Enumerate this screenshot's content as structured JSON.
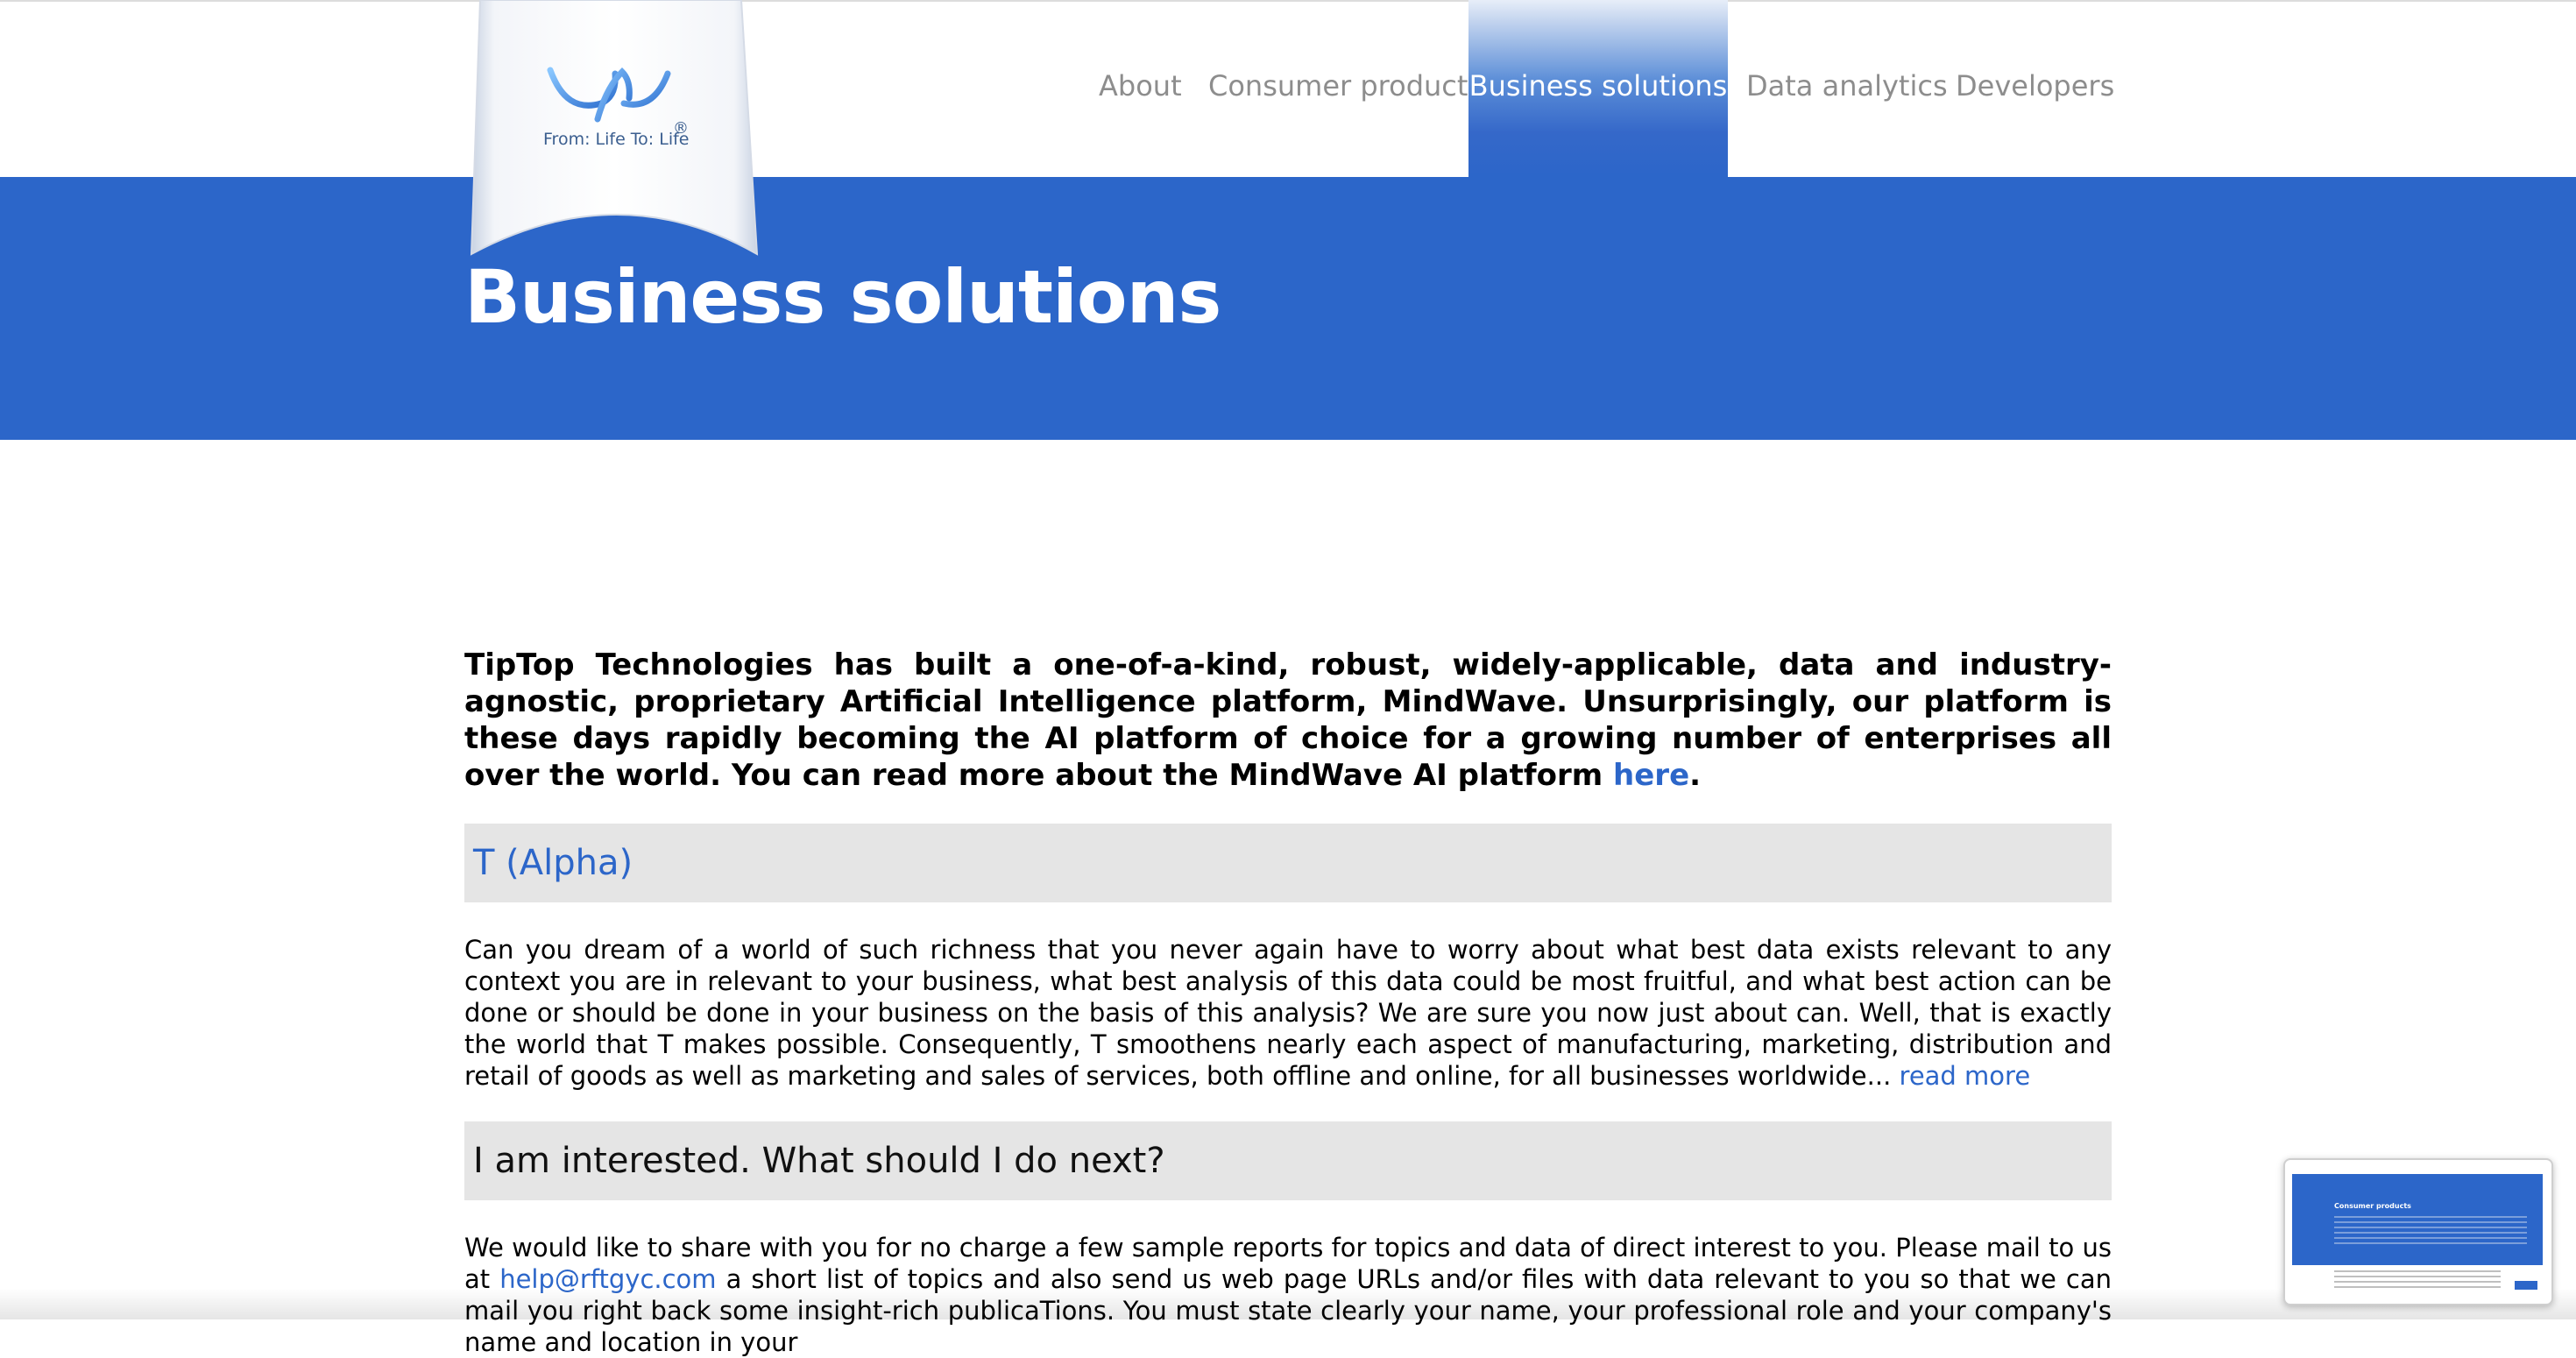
{
  "brand": {
    "tagline": "From: Life To: Life",
    "registered_mark": "®"
  },
  "nav": {
    "items": [
      {
        "label": "About"
      },
      {
        "label": "Consumer products"
      },
      {
        "label": "Business solutions",
        "active": true
      },
      {
        "label": "Data analytics"
      },
      {
        "label": "Developers"
      }
    ]
  },
  "page": {
    "title": "Business solutions"
  },
  "intro": {
    "text": "TipTop Technologies has built a one-of-a-kind, robust, widely-applicable, data and industry-agnostic, proprietary Artificial Intelligence platform, MindWave. Unsurprisingly, our platform is these days rapidly becoming the AI platform of choice for a growing number of enterprises all over the world. You can read more about the MindWave AI platform ",
    "link_label": "here",
    "end": "."
  },
  "sections": {
    "alpha": {
      "heading": "T (Alpha)",
      "body": "Can you dream of a world of such richness that you never again have to worry about what best data exists relevant to any context you are in relevant to your business, what best analysis of this data could be most fruitful, and what best action can be done or should be done in your business on the basis of this analysis? We are sure you now just about can. Well, that is exactly the world that T makes possible. Consequently, T smoothens nearly each aspect of manufacturing, marketing, distribution and retail of goods as well as marketing and sales of services, both offline and online, for all businesses worldwide... ",
      "read_more": "read more"
    },
    "next": {
      "heading": "I am interested. What should I do next?",
      "body_start": "We would like to share with you for no charge a few sample reports for topics and data of direct interest to you. Please mail to us at ",
      "email": "help@rftgyc.com",
      "body_end": " a short list of topics and also send us web page URLs and/or files with data relevant to you so that we can mail you right back some insight-rich publicaTions. You must state clearly your name, your professional role and your company's name and location in your"
    }
  },
  "thumbnail": {
    "title": "Consumer products"
  },
  "colors": {
    "accent": "#2c66c9",
    "nav_text": "#8d8d8d",
    "section_bg": "#e5e5e5"
  }
}
